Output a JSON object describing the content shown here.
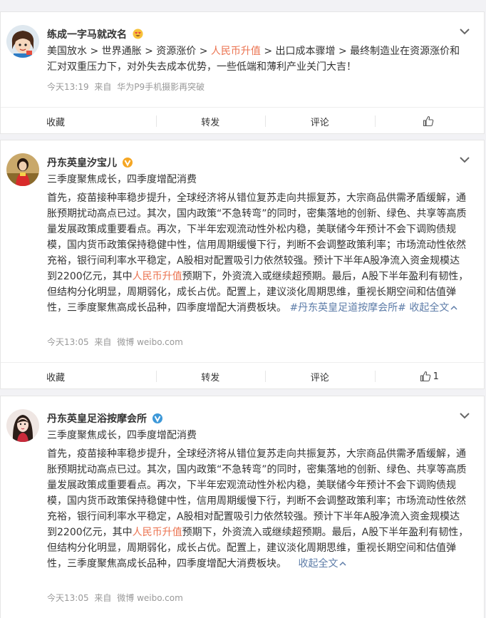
{
  "posts": [
    {
      "nickname": "练成一字马就改名",
      "segments": [
        "美国放水 > 世界通胀 > 资源涨价 > ",
        "人民币升值",
        " > 出口成本骤增 > 最终制造业在资源涨价和汇对双重压力下，对外失去成本优势，一些低端和薄利产业关门大吉！"
      ],
      "time": "今天13:19",
      "source_prefix": "来自",
      "source": "华为P9手机摄影再突破",
      "actions": {
        "collect": "收藏",
        "repost": "转发",
        "comment": "评论",
        "like_count": ""
      }
    },
    {
      "nickname": "丹东英皇汐宝儿",
      "summary": "三季度聚焦成长，四季度增配消费",
      "segments": [
        "首先，疫苗接种率稳步提升，全球经济将从错位复苏走向共振复苏，大宗商品供需矛盾缓解，通胀预期扰动高点已过。其次，国内政策“不急转弯”的同时，密集落地的创新、绿色、共享等高质量发展政策成重要看点。再次，下半年宏观流动性外松内稳，美联储今年预计不会下调购债规模，国内货币政策保持稳健中性，信用周期缓慢下行，判断不会调整政策利率；市场流动性依然充裕，银行间利率水平稳定，A股相对配置吸引力依然较强。预计下半年A股净流入资金规模达到2200亿元，其中",
        "人民币升值",
        "预期下，外资流入或继续超预期。最后，A股下半年盈利有韧性，但结构分化明显，周期弱化，成长占优。配置上，建议淡化周期思维，重视长期空间和估值弹性，三季度聚焦高成长品种，四季度增配大消费板块。"
      ],
      "topic": "#丹东英皇足道按摩会所#",
      "collapse": "收起全文",
      "time": "今天13:05",
      "source_prefix": "来自",
      "source": "微博 weibo.com",
      "actions": {
        "collect": "收藏",
        "repost": "转发",
        "comment": "评论",
        "like_count": "1"
      }
    },
    {
      "nickname": "丹东英皇足浴按摩会所",
      "summary": "三季度聚焦成长，四季度增配消费",
      "segments": [
        "首先，疫苗接种率稳步提升，全球经济将从错位复苏走向共振复苏，大宗商品供需矛盾缓解，通胀预期扰动高点已过。其次，国内政策“不急转弯”的同时，密集落地的创新、绿色、共享等高质量发展政策成重要看点。再次，下半年宏观流动性外松内稳，美联储今年预计不会下调购债规模，国内货币政策保持稳健中性，信用周期缓慢下行，判断不会调整政策利率；市场流动性依然充裕，银行间利率水平稳定，A股相对配置吸引力依然较强。预计下半年A股净流入资金规模达到2200亿元，其中",
        "人民币升值",
        "预期下，外资流入或继续超预期。最后，A股下半年盈利有韧性，但结构分化明显，周期弱化，成长占优。配置上，建议淡化周期思维，重视长期空间和估值弹性，三季度聚焦高成长品种，四季度增配大消费板块。"
      ],
      "collapse": "收起全文",
      "time": "今天13:05",
      "source_prefix": "来自",
      "source": "微博 weibo.com"
    }
  ]
}
